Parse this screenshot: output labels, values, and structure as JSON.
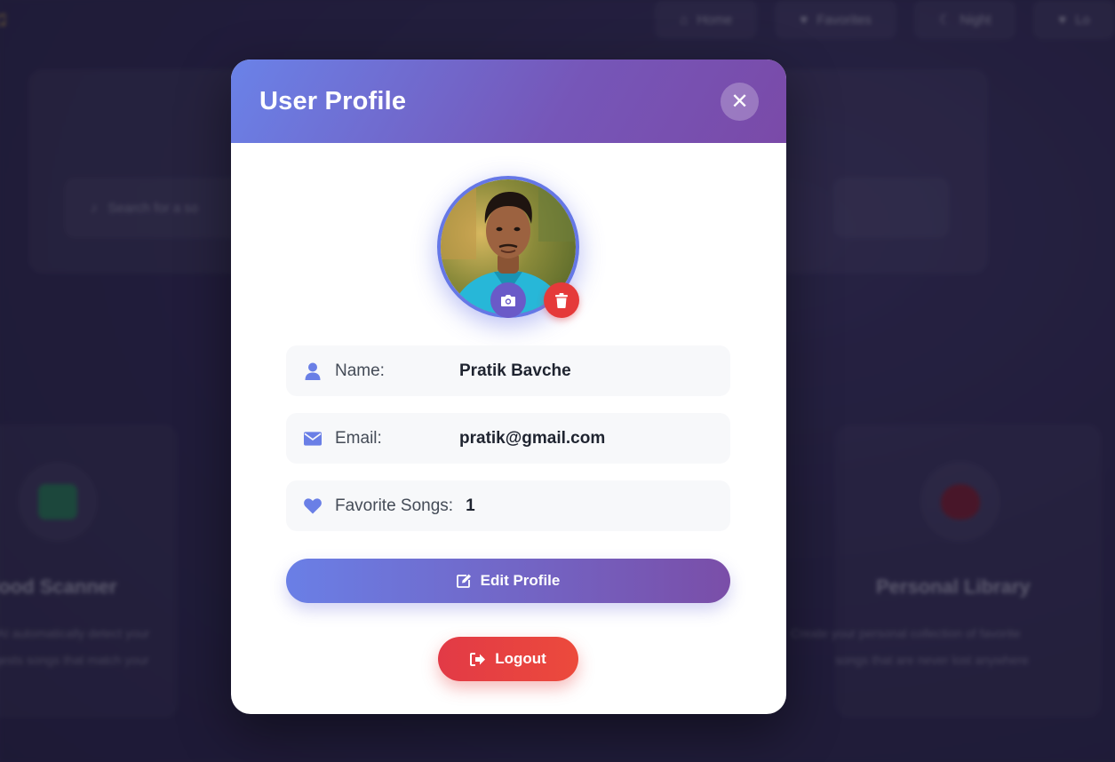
{
  "background": {
    "nav": [
      {
        "label": "Home",
        "icon": "home-icon"
      },
      {
        "label": "Favorites",
        "icon": "heart-icon"
      },
      {
        "label": "Night",
        "icon": "moon-icon"
      },
      {
        "label": "Lo",
        "icon": "heart-icon"
      }
    ],
    "search_placeholder": "Search for a so",
    "cards": {
      "left_title": "Mood Scanner",
      "left_text_1": "Our AI automatically detect your",
      "left_text_2": "suggests songs that match your",
      "right_title": "Personal Library",
      "right_text_1": "Create your personal collection of favorite",
      "right_text_2": "songs that are never lost anywhere"
    }
  },
  "modal": {
    "title": "User Profile",
    "close_icon": "close-icon",
    "avatar": {
      "camera_icon": "camera-icon",
      "delete_icon": "trash-icon"
    },
    "fields": {
      "name_label": "Name:",
      "name_value": "Pratik Bavche",
      "email_label": "Email:",
      "email_value": "pratik@gmail.com",
      "favorites_label": "Favorite Songs:",
      "favorites_value": "1"
    },
    "edit_button": "Edit Profile",
    "logout_button": "Logout"
  },
  "colors": {
    "accent": "#6577e6",
    "header_gradient_start": "#6a82e8",
    "header_gradient_end": "#7a4aa8",
    "danger": "#e53a3a"
  }
}
